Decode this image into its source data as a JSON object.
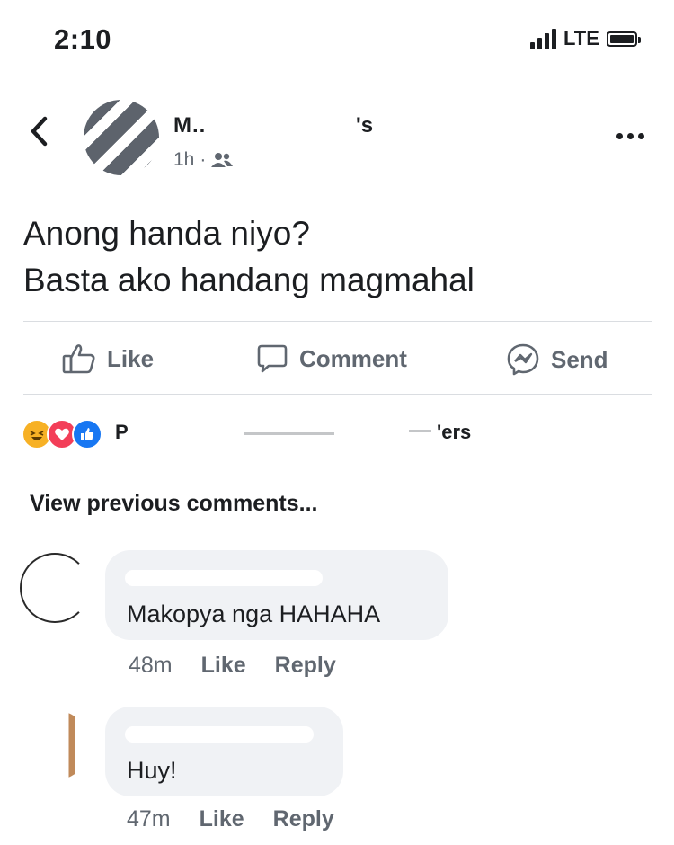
{
  "status_bar": {
    "time": "2:10",
    "network": "LTE"
  },
  "post": {
    "author": "M..",
    "author_suffix": "'s",
    "timestamp": "1h",
    "separator": "·",
    "audience_icon": "friends-icon",
    "text_lines": [
      "Anong handa niyo?",
      "Basta ako handang magmahal"
    ]
  },
  "actions": {
    "like": "Like",
    "comment": "Comment",
    "send": "Send"
  },
  "reactions": {
    "icons": [
      "haha",
      "love",
      "like"
    ],
    "summary_start": "P",
    "summary_end": "'ers"
  },
  "view_previous": "View previous comments...",
  "comments": [
    {
      "text": "Makopya nga HAHAHA",
      "time": "48m",
      "like": "Like",
      "reply": "Reply"
    },
    {
      "text": "Huy!",
      "time": "47m",
      "like": "Like",
      "reply": "Reply"
    }
  ],
  "colors": {
    "accent": "#1877f2",
    "love": "#f33e58",
    "haha": "#f7b125",
    "muted": "#606770",
    "bubble": "#f0f2f5"
  }
}
